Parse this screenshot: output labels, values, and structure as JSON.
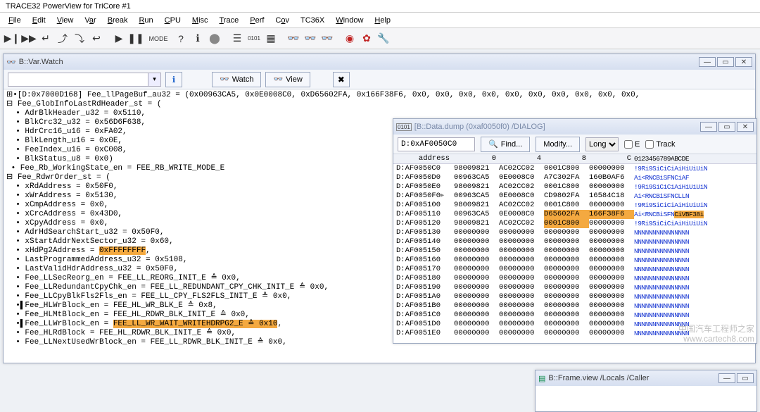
{
  "app": {
    "title": "TRACE32 PowerView for TriCore #1"
  },
  "menu": {
    "file": "File",
    "edit": "Edit",
    "view": "View",
    "var": "Var",
    "break": "Break",
    "run": "Run",
    "cpu": "CPU",
    "misc": "Misc",
    "trace": "Trace",
    "perf": "Perf",
    "cov": "Cov",
    "tc36x": "TC36X",
    "window": "Window",
    "help": "Help"
  },
  "varwatch": {
    "title": "B::Var.Watch",
    "watch_btn": "Watch",
    "view_btn": "View",
    "lines": [
      {
        "pre": "⊞•[D:0x7000D168] Fee_llPageBuf_au32 = (0x00963CA5, 0x0E0008C0, 0xD65602FA, 0x166F38F6, 0x0, 0x0, 0x0, 0x0, 0x0, 0x0, 0x0, 0x0, 0x0, 0x0,"
      },
      {
        "pre": "⊟ Fee_GlobInfoLastRdHeader_st = ("
      },
      {
        "pre": "  • AdrBlkHeader_u32 = 0x5110,"
      },
      {
        "pre": "  • BlkCrc32_u32 = 0x56D6F638,"
      },
      {
        "pre": "  • HdrCrc16_u16 = 0xFA02,"
      },
      {
        "pre": "  • BlkLength_u16 = 0x0E,"
      },
      {
        "pre": "  • FeeIndex_u16 = 0xC008,"
      },
      {
        "pre": "  • BlkStatus_u8 = 0x0)"
      },
      {
        "pre": " • Fee_Rb_WorkingState_en = FEE_RB_WRITE_MODE_E"
      },
      {
        "pre": "⊟ Fee_RdwrOrder_st = ("
      },
      {
        "pre": "  • xRdAddress = 0x50F0,"
      },
      {
        "pre": "  • xWrAddress = 0x5130,"
      },
      {
        "pre": "  • xCmpAddress = 0x0,"
      },
      {
        "pre": "  • xCrcAddress = 0x43D0,"
      },
      {
        "pre": "  • xCpyAddress = 0x0,"
      },
      {
        "pre": "  • AdrHdSearchStart_u32 = 0x50F0,"
      },
      {
        "pre": "  • xStartAddrNextSector_u32 = 0x60,"
      },
      {
        "pre": "  • xHdPg2Address = ",
        "hl": "0xFFFFFFFF",
        "post": ","
      },
      {
        "pre": "  • LastProgrammedAddress_u32 = 0x5108,"
      },
      {
        "pre": "  • LastValidHdrAddress_u32 = 0x50F0,"
      },
      {
        "pre": "  • Fee_LLSecReorg_en = FEE_LL_REORG_INIT_E ≙ 0x0,"
      },
      {
        "pre": "  • Fee_LLRedundantCpyChk_en = FEE_LL_REDUNDANT_CPY_CHK_INIT_E ≙ 0x0,"
      },
      {
        "pre": "  • Fee_LLCpyBlkFls2Fls_en = FEE_LL_CPY_FLS2FLS_INIT_E ≙ 0x0,"
      },
      {
        "pre": "  •▌Fee_HLWrBlock_en = FEE_HL_WR_BLK_E ≙ 0x8,"
      },
      {
        "pre": "  • Fee_HLMtBlock_en = FEE_HL_RDWR_BLK_INIT_E ≙ 0x0,"
      },
      {
        "pre": "  •▌Fee_LLWrBlock_en = ",
        "hl": "FEE_LL_WR_WAIT_WRITEHDRPG2_E ≙ 0x10",
        "post": ","
      },
      {
        "pre": "  • Fee_HLRdBlock = FEE_HL_RDWR_BLK_INIT_E ≙ 0x0,"
      },
      {
        "pre": "  • Fee_LLNextUsedWrBlock_en = FEE_LL_RDWR_BLK_INIT_E ≙ 0x0,"
      }
    ]
  },
  "dump": {
    "title": "[B::Data.dump (0xaf0050f0) /DIALOG]",
    "addr_value": "D:0xAF0050C0",
    "find_btn": "Find...",
    "modify_btn": "Modify...",
    "long_opt": "Long",
    "e_label": "E",
    "track_label": "Track",
    "head_addr": "address",
    "h0": "0",
    "h4": "4",
    "h8": "8",
    "hC": "C",
    "hT": "0123456789ABCDE",
    "rows": [
      {
        "a": "D:AF0050C0",
        "d": [
          "98009821",
          "AC02CC02",
          "0001C800",
          "00000000"
        ],
        "t": "!9Ri9SiCiCiAiHiUiUiN"
      },
      {
        "a": "D:AF0050D0",
        "d": [
          "00963CA5",
          "0E0008C0",
          "A7C302FA",
          "160B0AF6"
        ],
        "t": "Ai<RNCBiSFNCiAF"
      },
      {
        "a": "D:AF0050E0",
        "d": [
          "98009821",
          "AC02CC02",
          "0001C800",
          "00000000"
        ],
        "t": "!9Ri9SiCiCiAiHiUiUiN"
      },
      {
        "a": "D:AF0050F0",
        "d": [
          "00963CA5",
          "0E0008C0",
          "CD9802FA",
          "16584C18"
        ],
        "t": "Ai<RNCBiSFNCLLN",
        "ptr": true
      },
      {
        "a": "D:AF005100",
        "d": [
          "98009821",
          "AC02CC02",
          "0001C800",
          "00000000"
        ],
        "t": "!9Ri9SiCiCiAiHiUiUiN"
      },
      {
        "a": "D:AF005110",
        "d": [
          "00963CA5",
          "0E0008C0",
          "D65602FA",
          "166F38F6"
        ],
        "t": "Ai<RNCBiSFNCiVBF38i",
        "hi": [
          2,
          3
        ],
        "hiT": true
      },
      {
        "a": "D:AF005120",
        "d": [
          "98009821",
          "AC02CC02",
          "0001C800",
          "00000000"
        ],
        "t": "!9Ri9SiCiCiAiHiUiUiN",
        "hi": [
          2
        ]
      },
      {
        "a": "D:AF005130",
        "d": [
          "00000000",
          "00000000",
          "00000000",
          "00000000"
        ],
        "t": "NNNNNNNNNNNNNNN"
      },
      {
        "a": "D:AF005140",
        "d": [
          "00000000",
          "00000000",
          "00000000",
          "00000000"
        ],
        "t": "NNNNNNNNNNNNNNN"
      },
      {
        "a": "D:AF005150",
        "d": [
          "00000000",
          "00000000",
          "00000000",
          "00000000"
        ],
        "t": "NNNNNNNNNNNNNNN"
      },
      {
        "a": "D:AF005160",
        "d": [
          "00000000",
          "00000000",
          "00000000",
          "00000000"
        ],
        "t": "NNNNNNNNNNNNNNN"
      },
      {
        "a": "D:AF005170",
        "d": [
          "00000000",
          "00000000",
          "00000000",
          "00000000"
        ],
        "t": "NNNNNNNNNNNNNNN"
      },
      {
        "a": "D:AF005180",
        "d": [
          "00000000",
          "00000000",
          "00000000",
          "00000000"
        ],
        "t": "NNNNNNNNNNNNNNN"
      },
      {
        "a": "D:AF005190",
        "d": [
          "00000000",
          "00000000",
          "00000000",
          "00000000"
        ],
        "t": "NNNNNNNNNNNNNNN"
      },
      {
        "a": "D:AF0051A0",
        "d": [
          "00000000",
          "00000000",
          "00000000",
          "00000000"
        ],
        "t": "NNNNNNNNNNNNNNN"
      },
      {
        "a": "D:AF0051B0",
        "d": [
          "00000000",
          "00000000",
          "00000000",
          "00000000"
        ],
        "t": "NNNNNNNNNNNNNNN"
      },
      {
        "a": "D:AF0051C0",
        "d": [
          "00000000",
          "00000000",
          "00000000",
          "00000000"
        ],
        "t": "NNNNNNNNNNNNNNN"
      },
      {
        "a": "D:AF0051D0",
        "d": [
          "00000000",
          "00000000",
          "00000000",
          "00000000"
        ],
        "t": "NNNNNNNNNNNNNNN"
      },
      {
        "a": "D:AF0051E0",
        "d": [
          "00000000",
          "00000000",
          "00000000",
          "00000000"
        ],
        "t": "NNNNNNNNNNNNNNN"
      }
    ]
  },
  "frame": {
    "title": "B::Frame.view /Locals /Caller"
  },
  "watermark": {
    "line1": "中国汽车工程师之家",
    "line2": "www.cartech8.com"
  }
}
